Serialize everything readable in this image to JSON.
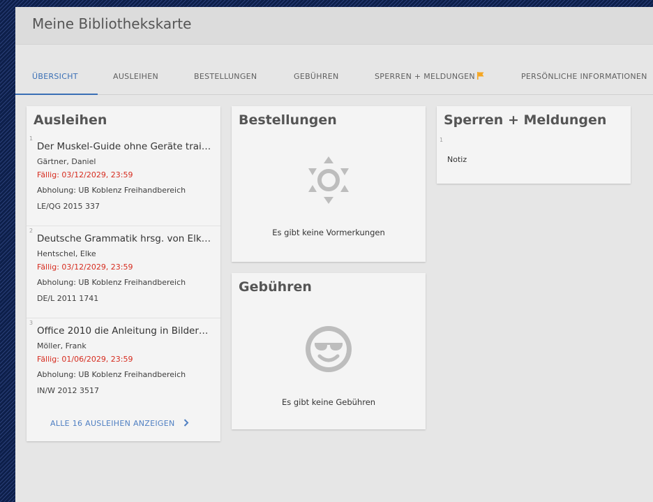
{
  "header": {
    "title": "Meine Bibliothekskarte"
  },
  "tabs": [
    {
      "label": "ÜBERSICHT",
      "active": true
    },
    {
      "label": "AUSLEIHEN"
    },
    {
      "label": "BESTELLUNGEN"
    },
    {
      "label": "GEBÜHREN"
    },
    {
      "label": "SPERREN + MELDUNGEN",
      "icon": "flag-icon"
    },
    {
      "label": "PERSÖNLICHE INFORMATIONEN"
    }
  ],
  "loans": {
    "title": "Ausleihen",
    "items": [
      {
        "num": "1",
        "title": "Der Muskel-Guide ohne Geräte trai…",
        "author": "Gärtner, Daniel",
        "due": "Fällig: 03/12/2029, 23:59",
        "pickup": "Abholung: UB Koblenz Freihandbereich",
        "signature": "LE/QG 2015 337"
      },
      {
        "num": "2",
        "title": "Deutsche Grammatik hrsg. von Elk…",
        "author": "Hentschel, Elke",
        "due": "Fällig: 03/12/2029, 23:59",
        "pickup": "Abholung: UB Koblenz Freihandbereich",
        "signature": "DE/L 2011 1741"
      },
      {
        "num": "3",
        "title": "Office 2010 die Anleitung in Bilder…",
        "author": "Möller, Frank",
        "due": "Fällig: 01/06/2029, 23:59",
        "pickup": "Abholung: UB Koblenz Freihandbereich",
        "signature": "IN/W 2012 3517"
      }
    ],
    "show_all": "ALLE 16 AUSLEIHEN ANZEIGEN"
  },
  "orders": {
    "title": "Bestellungen",
    "icon": "sun-icon",
    "empty": "Es gibt keine Vormerkungen"
  },
  "fees": {
    "title": "Gebühren",
    "icon": "sunglasses-smiley-icon",
    "empty": "Es gibt keine Gebühren"
  },
  "notices": {
    "title": "Sperren + Meldungen",
    "items": [
      {
        "num": "1",
        "text": "Notiz"
      }
    ]
  },
  "colors": {
    "accent": "#3a6fb5",
    "due": "#d62b1e",
    "flag": "#f5a623",
    "icon_gray": "#bdbdbd"
  }
}
